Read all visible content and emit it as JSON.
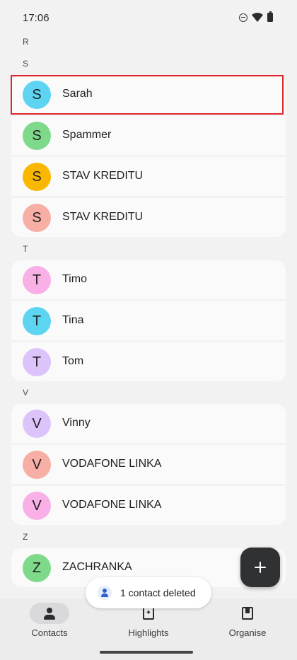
{
  "status_bar": {
    "time": "17:06",
    "icons": [
      "dnd-icon",
      "wifi-icon",
      "battery-icon"
    ]
  },
  "sections": [
    {
      "letter": "R",
      "contacts": []
    },
    {
      "letter": "S",
      "contacts": [
        {
          "initial": "S",
          "name": "Sarah",
          "avatar_color": "#5dd5f2"
        },
        {
          "initial": "S",
          "name": "Spammer",
          "avatar_color": "#7fd98a"
        },
        {
          "initial": "S",
          "name": "STAV KREDITU",
          "avatar_color": "#f9b700"
        },
        {
          "initial": "S",
          "name": "STAV KREDITU",
          "avatar_color": "#f7aea4"
        }
      ]
    },
    {
      "letter": "T",
      "contacts": [
        {
          "initial": "T",
          "name": "Timo",
          "avatar_color": "#f8b0e6"
        },
        {
          "initial": "T",
          "name": "Tina",
          "avatar_color": "#5dd5f2"
        },
        {
          "initial": "T",
          "name": "Tom",
          "avatar_color": "#dcc4fb"
        }
      ]
    },
    {
      "letter": "V",
      "contacts": [
        {
          "initial": "V",
          "name": "Vinny",
          "avatar_color": "#dcc4fb"
        },
        {
          "initial": "V",
          "name": "VODAFONE LINKA",
          "avatar_color": "#f7aea4"
        },
        {
          "initial": "V",
          "name": "VODAFONE LINKA",
          "avatar_color": "#f8b0e6"
        }
      ]
    },
    {
      "letter": "Z",
      "contacts": [
        {
          "initial": "Z",
          "name": "ZACHRANKA",
          "avatar_color": "#7fd98a"
        }
      ]
    }
  ],
  "fab": {
    "icon": "plus-icon"
  },
  "snackbar": {
    "icon": "person-icon",
    "text": "1 contact deleted"
  },
  "bottom_nav": {
    "items": [
      {
        "label": "Contacts",
        "icon": "person-icon",
        "active": true
      },
      {
        "label": "Highlights",
        "icon": "highlights-icon",
        "active": false
      },
      {
        "label": "Organise",
        "icon": "organise-icon",
        "active": false
      }
    ]
  },
  "colors": {
    "highlight_border": "#e0262b",
    "fab_bg": "#2f3133"
  }
}
